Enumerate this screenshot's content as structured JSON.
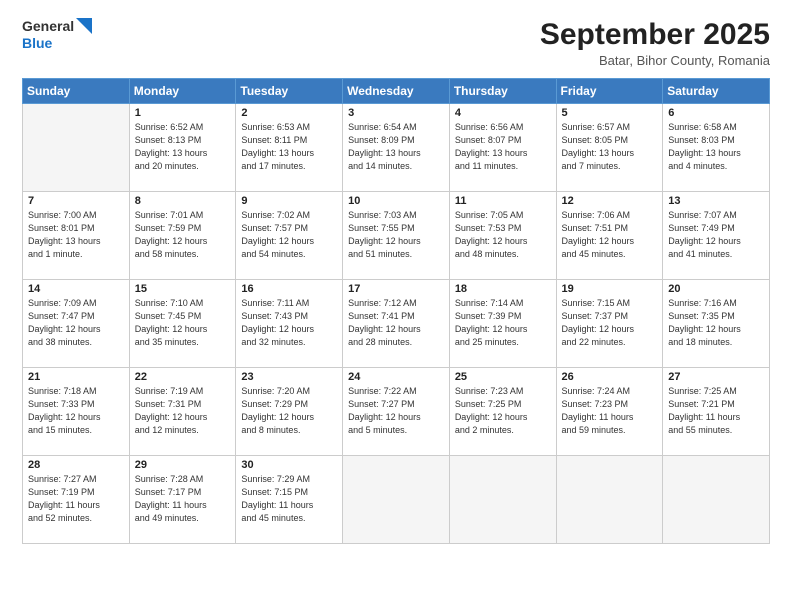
{
  "header": {
    "logo_line1": "General",
    "logo_line2": "Blue",
    "month": "September 2025",
    "location": "Batar, Bihor County, Romania"
  },
  "weekdays": [
    "Sunday",
    "Monday",
    "Tuesday",
    "Wednesday",
    "Thursday",
    "Friday",
    "Saturday"
  ],
  "weeks": [
    [
      {
        "day": "",
        "info": ""
      },
      {
        "day": "1",
        "info": "Sunrise: 6:52 AM\nSunset: 8:13 PM\nDaylight: 13 hours\nand 20 minutes."
      },
      {
        "day": "2",
        "info": "Sunrise: 6:53 AM\nSunset: 8:11 PM\nDaylight: 13 hours\nand 17 minutes."
      },
      {
        "day": "3",
        "info": "Sunrise: 6:54 AM\nSunset: 8:09 PM\nDaylight: 13 hours\nand 14 minutes."
      },
      {
        "day": "4",
        "info": "Sunrise: 6:56 AM\nSunset: 8:07 PM\nDaylight: 13 hours\nand 11 minutes."
      },
      {
        "day": "5",
        "info": "Sunrise: 6:57 AM\nSunset: 8:05 PM\nDaylight: 13 hours\nand 7 minutes."
      },
      {
        "day": "6",
        "info": "Sunrise: 6:58 AM\nSunset: 8:03 PM\nDaylight: 13 hours\nand 4 minutes."
      }
    ],
    [
      {
        "day": "7",
        "info": "Sunrise: 7:00 AM\nSunset: 8:01 PM\nDaylight: 13 hours\nand 1 minute."
      },
      {
        "day": "8",
        "info": "Sunrise: 7:01 AM\nSunset: 7:59 PM\nDaylight: 12 hours\nand 58 minutes."
      },
      {
        "day": "9",
        "info": "Sunrise: 7:02 AM\nSunset: 7:57 PM\nDaylight: 12 hours\nand 54 minutes."
      },
      {
        "day": "10",
        "info": "Sunrise: 7:03 AM\nSunset: 7:55 PM\nDaylight: 12 hours\nand 51 minutes."
      },
      {
        "day": "11",
        "info": "Sunrise: 7:05 AM\nSunset: 7:53 PM\nDaylight: 12 hours\nand 48 minutes."
      },
      {
        "day": "12",
        "info": "Sunrise: 7:06 AM\nSunset: 7:51 PM\nDaylight: 12 hours\nand 45 minutes."
      },
      {
        "day": "13",
        "info": "Sunrise: 7:07 AM\nSunset: 7:49 PM\nDaylight: 12 hours\nand 41 minutes."
      }
    ],
    [
      {
        "day": "14",
        "info": "Sunrise: 7:09 AM\nSunset: 7:47 PM\nDaylight: 12 hours\nand 38 minutes."
      },
      {
        "day": "15",
        "info": "Sunrise: 7:10 AM\nSunset: 7:45 PM\nDaylight: 12 hours\nand 35 minutes."
      },
      {
        "day": "16",
        "info": "Sunrise: 7:11 AM\nSunset: 7:43 PM\nDaylight: 12 hours\nand 32 minutes."
      },
      {
        "day": "17",
        "info": "Sunrise: 7:12 AM\nSunset: 7:41 PM\nDaylight: 12 hours\nand 28 minutes."
      },
      {
        "day": "18",
        "info": "Sunrise: 7:14 AM\nSunset: 7:39 PM\nDaylight: 12 hours\nand 25 minutes."
      },
      {
        "day": "19",
        "info": "Sunrise: 7:15 AM\nSunset: 7:37 PM\nDaylight: 12 hours\nand 22 minutes."
      },
      {
        "day": "20",
        "info": "Sunrise: 7:16 AM\nSunset: 7:35 PM\nDaylight: 12 hours\nand 18 minutes."
      }
    ],
    [
      {
        "day": "21",
        "info": "Sunrise: 7:18 AM\nSunset: 7:33 PM\nDaylight: 12 hours\nand 15 minutes."
      },
      {
        "day": "22",
        "info": "Sunrise: 7:19 AM\nSunset: 7:31 PM\nDaylight: 12 hours\nand 12 minutes."
      },
      {
        "day": "23",
        "info": "Sunrise: 7:20 AM\nSunset: 7:29 PM\nDaylight: 12 hours\nand 8 minutes."
      },
      {
        "day": "24",
        "info": "Sunrise: 7:22 AM\nSunset: 7:27 PM\nDaylight: 12 hours\nand 5 minutes."
      },
      {
        "day": "25",
        "info": "Sunrise: 7:23 AM\nSunset: 7:25 PM\nDaylight: 12 hours\nand 2 minutes."
      },
      {
        "day": "26",
        "info": "Sunrise: 7:24 AM\nSunset: 7:23 PM\nDaylight: 11 hours\nand 59 minutes."
      },
      {
        "day": "27",
        "info": "Sunrise: 7:25 AM\nSunset: 7:21 PM\nDaylight: 11 hours\nand 55 minutes."
      }
    ],
    [
      {
        "day": "28",
        "info": "Sunrise: 7:27 AM\nSunset: 7:19 PM\nDaylight: 11 hours\nand 52 minutes."
      },
      {
        "day": "29",
        "info": "Sunrise: 7:28 AM\nSunset: 7:17 PM\nDaylight: 11 hours\nand 49 minutes."
      },
      {
        "day": "30",
        "info": "Sunrise: 7:29 AM\nSunset: 7:15 PM\nDaylight: 11 hours\nand 45 minutes."
      },
      {
        "day": "",
        "info": ""
      },
      {
        "day": "",
        "info": ""
      },
      {
        "day": "",
        "info": ""
      },
      {
        "day": "",
        "info": ""
      }
    ]
  ]
}
